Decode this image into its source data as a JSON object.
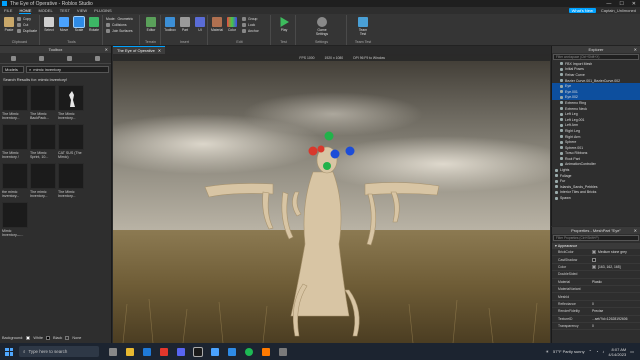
{
  "titlebar": {
    "title": "The Eye of Operative - Roblox Studio",
    "buttons": [
      "—",
      "☐",
      "✕"
    ]
  },
  "menu": {
    "tabs": [
      "FILE",
      "HOME",
      "MODEL",
      "TEST",
      "VIEW",
      "PLUGINS"
    ],
    "active": "HOME",
    "whats_new": "What's New",
    "user": "Captain_Unlimoned"
  },
  "ribbon": {
    "clipboard": {
      "paste": "Paste",
      "copy": "Copy",
      "cut": "Cut",
      "duplicate": "Duplicate",
      "label": "Clipboard"
    },
    "tools": {
      "select": "Select",
      "move": "Move",
      "scale": "Scale",
      "rotate": "Rotate",
      "label": "Tools"
    },
    "mode": {
      "mode": "Mode:",
      "mode_value": "Geometric",
      "collisions": "Collisions",
      "join": "Join Surfaces"
    },
    "terrain": {
      "editor": "Editor",
      "label": "Terrain"
    },
    "insert": {
      "toolbox": "Toolbox",
      "part": "Part",
      "ui": "UI",
      "label": "Insert"
    },
    "edit": {
      "material": "Material",
      "color": "Color",
      "group": "Group",
      "lock": "Lock",
      "anchor": "Anchor",
      "label": "Edit"
    },
    "test": {
      "play": "Play",
      "label": "Test"
    },
    "settings": {
      "game_settings": "Game Settings",
      "label": "Settings"
    },
    "team_test": {
      "team_test": "Team Test",
      "label": "Team Test"
    }
  },
  "toolbox": {
    "title": "Toolbox",
    "category_select": "Models",
    "search_value": "mimic inventory",
    "results_text": "Search Results for: mimic inventory!",
    "items": [
      {
        "name": "The Mimic Inventory..."
      },
      {
        "name": "The Mimic BackPack..."
      },
      {
        "name": "The Mimic Inventory..."
      },
      {
        "name": "The Mimic Inventory /"
      },
      {
        "name": "The Mimic Sprint, 10..."
      },
      {
        "name": "CAT SUS (The Mimic)"
      },
      {
        "name": "the mimic inventory..."
      },
      {
        "name": "The mimic Inventory..."
      },
      {
        "name": "The Mimic Inventory..."
      },
      {
        "name": "Mimic Inventory---..."
      }
    ],
    "background_label": "Background:",
    "background_options": [
      "White",
      "Black",
      "None"
    ]
  },
  "viewport": {
    "tab_title": "The Eye of Operative",
    "info": [
      "FPS 1000",
      "1920 x 1080",
      "DPI 96"
    ],
    "fullscreen": "F9 to Window"
  },
  "explorer": {
    "title": "Explorer",
    "filter_placeholder": "Filter workspace (Ctrl+Shift+X)",
    "rows": [
      {
        "label": "FBX Import Mesh",
        "selected": false
      },
      {
        "label": "Initial Poses",
        "selected": false
      },
      {
        "label": "Rebar Curve",
        "selected": false
      },
      {
        "label": "Bezier Curve.001_BezierCurve.002",
        "selected": false
      },
      {
        "label": "Eye",
        "selected": true
      },
      {
        "label": "Eye.001",
        "selected": true
      },
      {
        "label": "Eye.002",
        "selected": true
      },
      {
        "label": "Extremo Ring",
        "selected": false
      },
      {
        "label": "Extremo Neck",
        "selected": false
      },
      {
        "label": "Left Leg",
        "selected": false
      },
      {
        "label": "Left Leg.001",
        "selected": false
      },
      {
        "label": "Left Arm",
        "selected": false
      },
      {
        "label": "Right Leg",
        "selected": false
      },
      {
        "label": "Right Arm",
        "selected": false
      },
      {
        "label": "Sphere",
        "selected": false
      },
      {
        "label": "Sphere.001",
        "selected": false
      },
      {
        "label": "Torso Ribbons",
        "selected": false
      },
      {
        "label": "Root Part",
        "selected": false
      },
      {
        "label": "AnimationController",
        "selected": false
      },
      {
        "label": "Lights",
        "selected": false
      },
      {
        "label": "Foliage",
        "selected": false
      },
      {
        "label": "Fur",
        "selected": false
      },
      {
        "label": "Islands_Sands_Pebbles",
        "selected": false
      },
      {
        "label": "Interior Tiles and Bricks",
        "selected": false
      },
      {
        "label": "Spawn",
        "selected": false
      }
    ]
  },
  "properties": {
    "title": "Properties - MeshPart \"Eye\"",
    "filter_placeholder": "Filter Properties (Ctrl+Shift+P)",
    "section": "Appearance",
    "rows": [
      {
        "key": "BrickColor",
        "value": "Medium stone grey",
        "swatch": "#a3a2a5"
      },
      {
        "key": "CastShadow",
        "value": "",
        "checkbox": true
      },
      {
        "key": "Color",
        "value": "[163, 162, 165]",
        "swatch": "#a3a2a5"
      },
      {
        "key": "DoubleSided",
        "value": ""
      },
      {
        "key": "Material",
        "value": "Plastic"
      },
      {
        "key": "MaterialVariant",
        "value": ""
      },
      {
        "key": "MeshId",
        "value": ""
      },
      {
        "key": "Reflectance",
        "value": "0"
      },
      {
        "key": "RenderFidelity",
        "value": "Precise"
      },
      {
        "key": "TextureID",
        "value": "...set/?id=12628192606"
      },
      {
        "key": "Transparency",
        "value": "0"
      }
    ]
  },
  "taskbar": {
    "search_placeholder": "Type here to search",
    "weather": "57°F  Partly sunny",
    "time": "8:07 AM",
    "date": "4/14/2023"
  }
}
